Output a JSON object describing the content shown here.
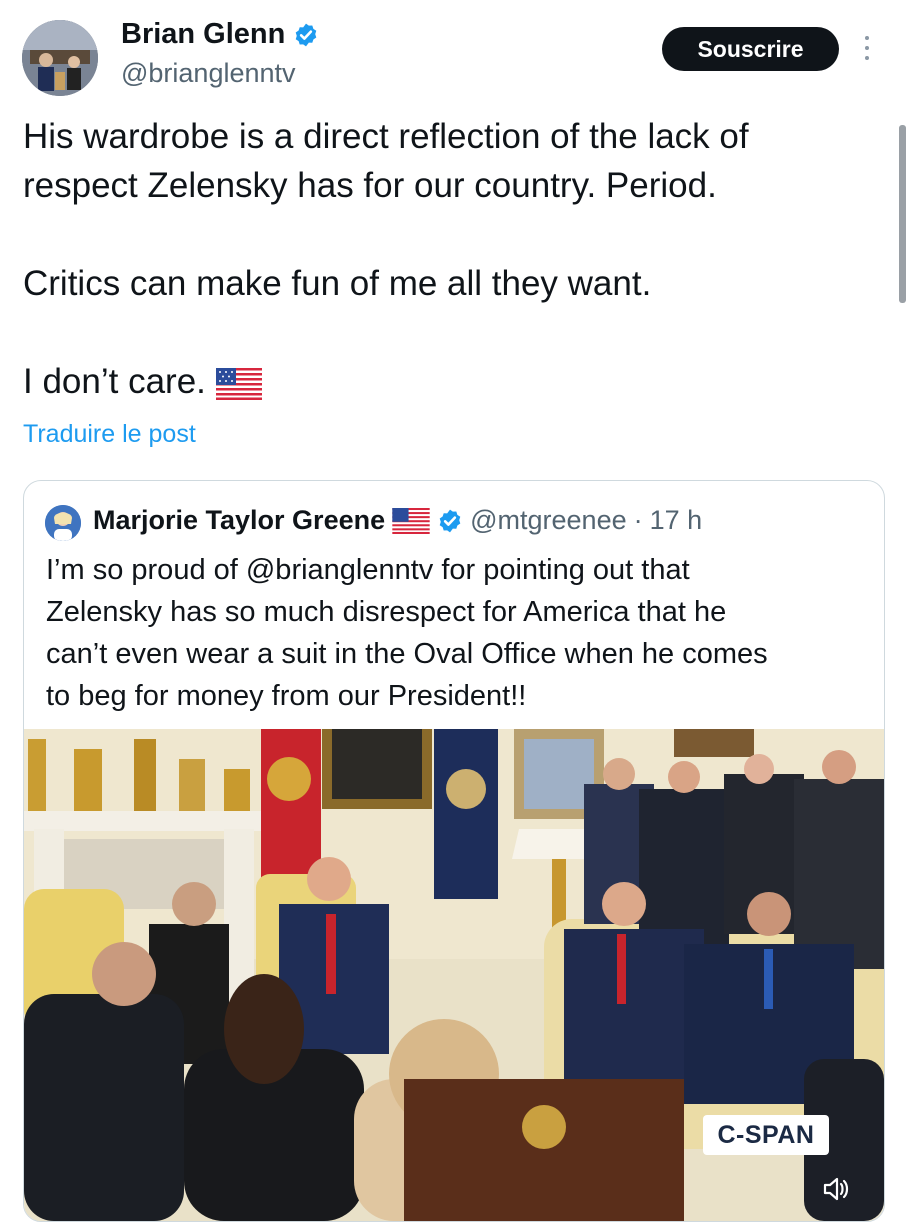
{
  "author": {
    "name": "Brian Glenn",
    "handle": "@brianglenntv"
  },
  "header": {
    "subscribe_label": "Souscrire"
  },
  "post": {
    "line1": "His wardrobe is a direct reflection of the lack of",
    "line2": "respect Zelensky has for our country. Period.",
    "line3": "Critics can make fun of me all they want.",
    "line4": "I don’t care.",
    "translate_label": "Traduire le post"
  },
  "quote": {
    "name": "Marjorie Taylor Greene",
    "handle": "@mtgreenee",
    "separator": "·",
    "time": "17 h",
    "text_lines": [
      "I’m so proud of @brianglenntv for pointing out that",
      "Zelensky has so much disrespect for America that he",
      "can’t even wear a suit in the Oval Office when he comes",
      "to beg for money from our President!!"
    ],
    "video_watermark": "C-SPAN"
  },
  "icons": {
    "verified": "verified-badge-icon",
    "more": "more-options-icon",
    "flag": "us-flag-icon",
    "volume": "volume-icon"
  },
  "colors": {
    "link": "#1d9bf0",
    "verified": "#1d9bf0",
    "button_bg": "#0f1419",
    "secondary_text": "#536471"
  }
}
